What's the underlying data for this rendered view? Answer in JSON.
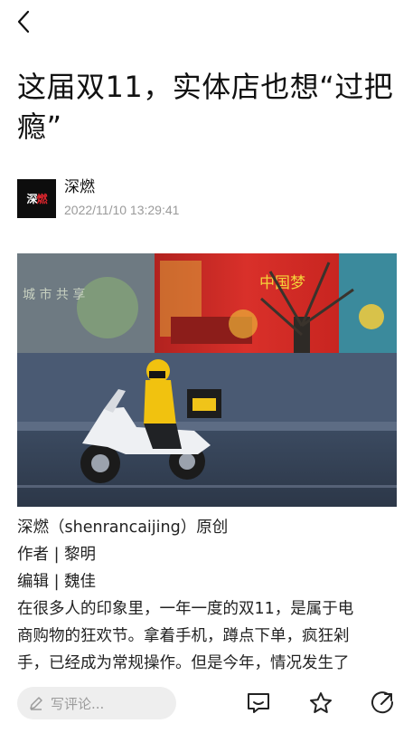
{
  "article": {
    "title": "这届双11，实体店也想“过把瘾”",
    "author_name": "深燃",
    "author_logo_text_a": "深",
    "author_logo_text_b": "燃",
    "publish_time": "2022/11/10 13:29:41"
  },
  "hero_image": {
    "sign_left": "城 市 共 享",
    "sign_center": "中国梦"
  },
  "body": {
    "source_line": "深燃（shenrancaijing）原创",
    "author_line": "作者 | 黎明",
    "editor_line": "编辑 | 魏佳",
    "para1_line1": "在很多人的印象里，一年一度的双11，是属于电",
    "para1_line2": "商购物的狂欢节。拿着手机，蹲点下单，疯狂剁",
    "para1_line3": "手，已经成为常规操作。但是今年，情况发生了"
  },
  "bottom_bar": {
    "comment_placeholder": "写评论..."
  },
  "colors": {
    "text": "#111111",
    "muted": "#9a9a9a",
    "input_bg": "#eeeeee"
  }
}
